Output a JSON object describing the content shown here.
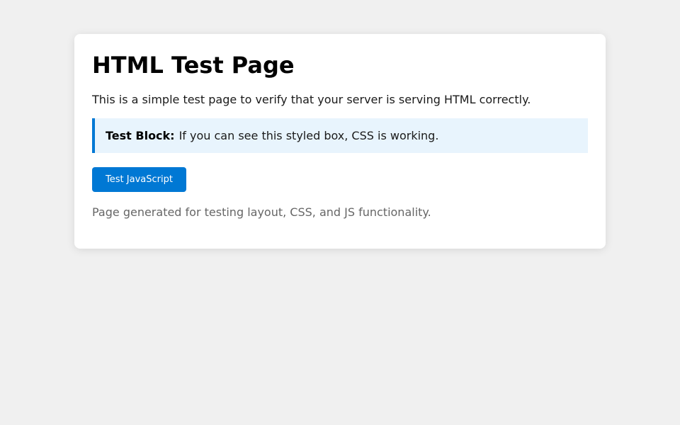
{
  "page": {
    "title": "HTML Test Page",
    "intro": "This is a simple test page to verify that your server is serving HTML correctly.",
    "test_block": {
      "label": "Test Block:",
      "text": "If you can see this styled box, CSS is working."
    },
    "button_label": "Test JavaScript",
    "footer": "Page generated for testing layout, CSS, and JS functionality."
  },
  "colors": {
    "accent": "#0078d4",
    "block_background": "#e8f4fd",
    "page_background": "#f0f0f0",
    "muted_text": "#666666"
  }
}
